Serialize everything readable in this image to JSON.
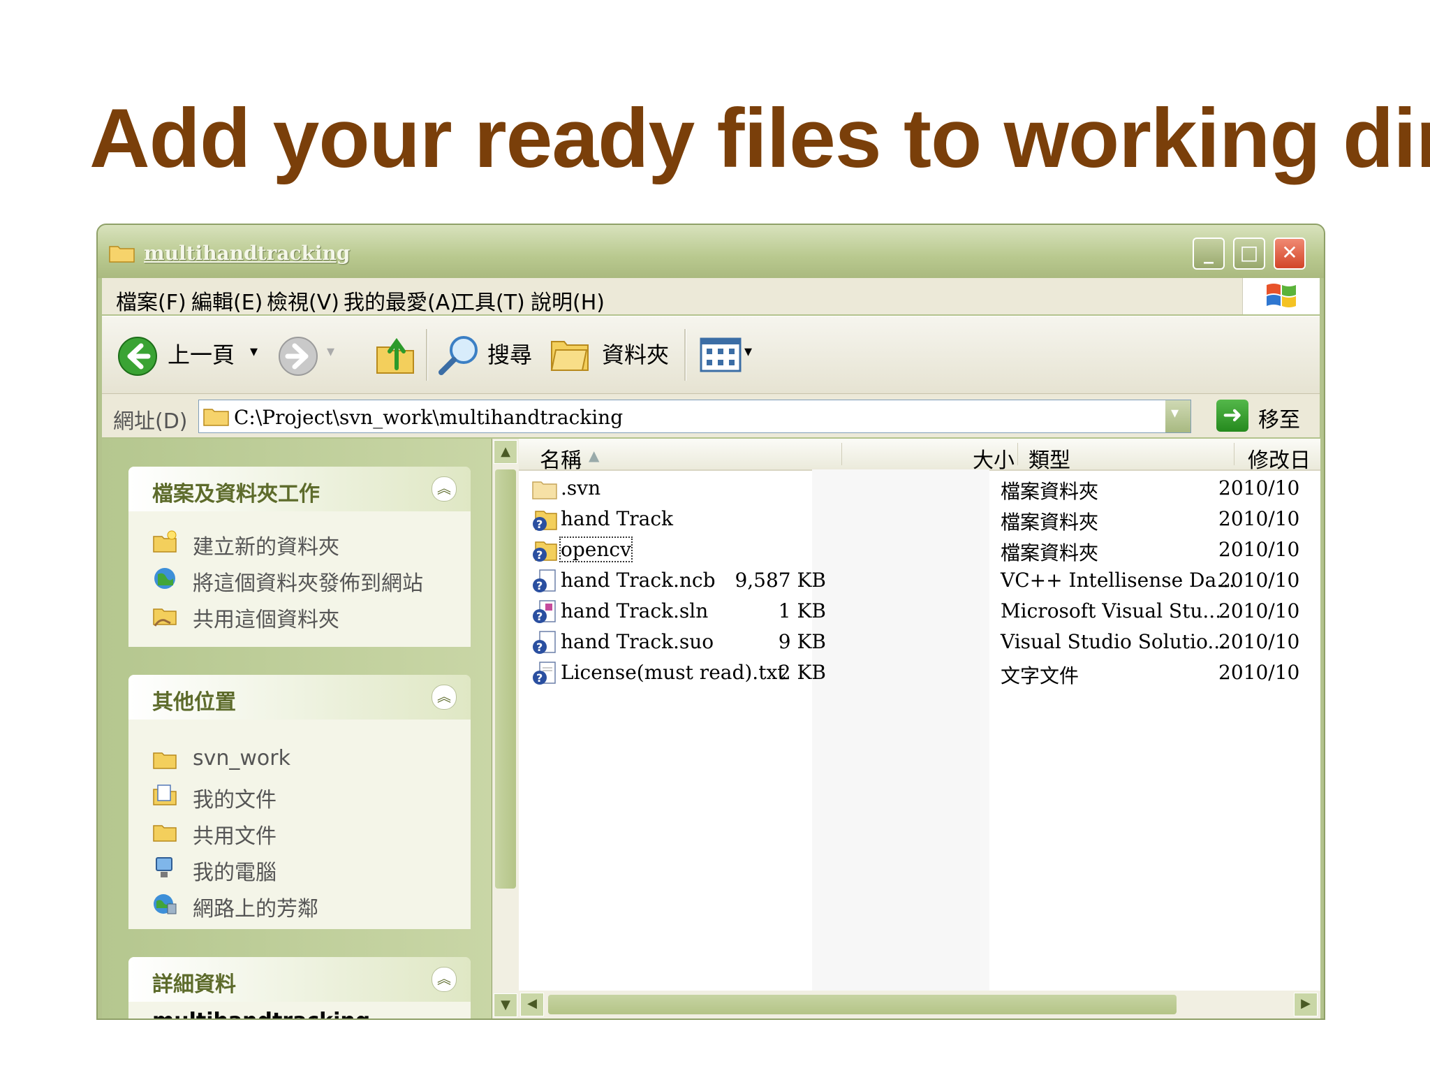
{
  "slide": {
    "title": "Add your ready files to working dir"
  },
  "window": {
    "title": "multihandtracking",
    "controls": {
      "minimize": "_",
      "maximize": "□",
      "close": "✕"
    }
  },
  "menubar": {
    "items": [
      "檔案(F)",
      "編輯(E)",
      "檢視(V)",
      "我的最愛(A)",
      "工具(T)",
      "說明(H)"
    ]
  },
  "toolbar": {
    "back_label": "上一頁",
    "back_dropdown": "▾",
    "forward_dropdown": "▾",
    "search_label": "搜尋",
    "folders_label": "資料夾",
    "views_dropdown": "▾"
  },
  "addressbar": {
    "label": "網址(D)",
    "path": "C:\\Project\\svn_work\\multihandtracking",
    "go_label": "移至",
    "go_arrow": "➜",
    "drop_arrow": "▾"
  },
  "tasks": {
    "file_tasks": {
      "title": "檔案及資料夾工作",
      "items": [
        "建立新的資料夾",
        "將這個資料夾發佈到網站",
        "共用這個資料夾"
      ]
    },
    "other_places": {
      "title": "其他位置",
      "items": [
        "svn_work",
        "我的文件",
        "共用文件",
        "我的電腦",
        "網路上的芳鄰"
      ]
    },
    "details": {
      "title": "詳細資料",
      "partial_text": "multihandtracking"
    },
    "collapse_symbol": "︽"
  },
  "file_list": {
    "columns": {
      "name": "名稱",
      "size": "大小",
      "type": "類型",
      "modified": "修改日"
    },
    "sort_indicator": "▲",
    "rows": [
      {
        "name": ".svn",
        "size": "",
        "type": "檔案資料夾",
        "modified": "2010/10",
        "icon": "folder-icon"
      },
      {
        "name": "hand Track",
        "size": "",
        "type": "檔案資料夾",
        "modified": "2010/10",
        "icon": "svn-folder-icon"
      },
      {
        "name": "opencv",
        "size": "",
        "type": "檔案資料夾",
        "modified": "2010/10",
        "icon": "svn-folder-icon"
      },
      {
        "name": "hand Track.ncb",
        "size": "9,587 KB",
        "type": "VC++ Intellisense Da...",
        "modified": "2010/10",
        "icon": "svn-file-icon"
      },
      {
        "name": "hand Track.sln",
        "size": "1 KB",
        "type": "Microsoft Visual Stu...",
        "modified": "2010/10",
        "icon": "svn-sln-icon"
      },
      {
        "name": "hand Track.suo",
        "size": "9 KB",
        "type": "Visual Studio Solutio...",
        "modified": "2010/10",
        "icon": "svn-file-icon"
      },
      {
        "name": "License(must read).txt",
        "size": "2 KB",
        "type": "文字文件",
        "modified": "2010/10",
        "icon": "svn-text-icon"
      }
    ]
  },
  "scrollbars": {
    "up": "▲",
    "down": "▼",
    "left": "◀",
    "right": "▶"
  },
  "colors": {
    "title_brown": "#7a3f0a",
    "window_olive": "#b3c38d",
    "panel_title": "#5d6b2b"
  }
}
